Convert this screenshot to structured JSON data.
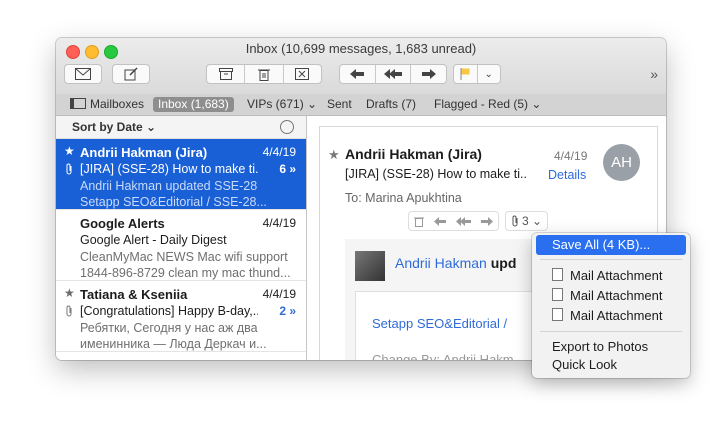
{
  "window": {
    "title": "Inbox (10,699 messages, 1,683 unread)"
  },
  "toolbar": {
    "icons": [
      "compose-mail-icon",
      "new-note-icon",
      "archive-icon",
      "trash-icon",
      "junk-icon",
      "reply-icon",
      "reply-all-icon",
      "forward-icon",
      "flag-icon"
    ],
    "flag_color": "#f6c744",
    "more": "»"
  },
  "favorites": {
    "mailboxes": "Mailboxes",
    "inbox": "Inbox (1,683)",
    "vips": "VIPs (671) ⌄",
    "sent": "Sent",
    "drafts": "Drafts (7)",
    "flagged": "Flagged - Red (5) ⌄"
  },
  "list": {
    "sort_label": "Sort by Date ⌄",
    "messages": [
      {
        "from": "Andrii Hakman (Jira)",
        "date": "4/4/19",
        "subject": "[JIRA] (SSE-28) How to make ti...",
        "count": "6 »",
        "preview1": "Andrii Hakman updated SSE-28",
        "preview2": "Setapp SEO&Editorial / SSE-28..."
      },
      {
        "from": "Google Alerts",
        "date": "4/4/19",
        "subject": "Google Alert - Daily Digest",
        "count": "",
        "preview1": "CleanMyMac NEWS Mac wifi support",
        "preview2": "1844-896-8729 clean my mac thund..."
      },
      {
        "from": "Tatiana & Kseniia",
        "date": "4/4/19",
        "subject": "[Congratulations] Happy B-day,...",
        "count": "2 »",
        "preview1": "Ребятки,  Сегодня у нас аж два",
        "preview2": "именинника — Люда Деркач и..."
      }
    ]
  },
  "reader": {
    "from": "Andrii Hakman (Jira)",
    "date": "4/4/19",
    "subject": "[JIRA] (SSE-28) How to make ti...",
    "details": "Details",
    "avatar_initials": "AH",
    "to_label": "To:",
    "to_name": "Marina Apukhtina",
    "attachment_count": "3 ⌄",
    "body_name": "Andrii Hakman",
    "body_upd": "upd",
    "body_line1": "Setapp SEO&Editorial /",
    "body_line2": "Change By: Andrii Hakm"
  },
  "menu": {
    "save_all": "Save All (4 KB)...",
    "attachments": [
      "Mail Attachment",
      "Mail Attachment",
      "Mail Attachment"
    ],
    "export": "Export to Photos",
    "quick_look": "Quick Look"
  }
}
